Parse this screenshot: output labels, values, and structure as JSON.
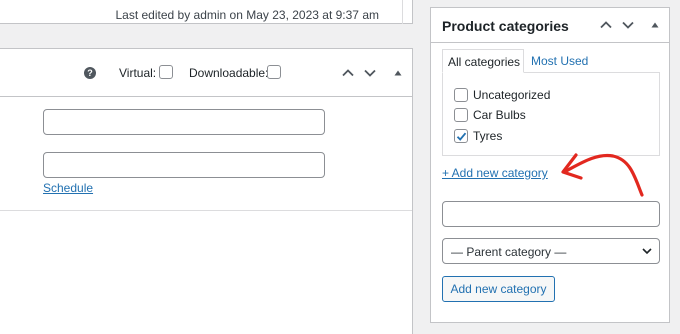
{
  "status": {
    "last_edited": "Last edited by admin on May 23, 2023 at 9:37 am"
  },
  "product_data": {
    "help_icon": "question-circle-icon",
    "virtual_label": "Virtual:",
    "virtual_checked": false,
    "downloadable_label": "Downloadable:",
    "downloadable_checked": false,
    "move_up_icon": "chevron-up-icon",
    "move_down_icon": "chevron-down-icon",
    "toggle_icon": "triangle-up-icon",
    "schedule_link": "Schedule"
  },
  "categories_box": {
    "title": "Product categories",
    "tabs": [
      {
        "label": "All categories",
        "active": true
      },
      {
        "label": "Most Used",
        "active": false
      }
    ],
    "items": [
      {
        "label": "Uncategorized",
        "checked": false
      },
      {
        "label": "Car Bulbs",
        "checked": false
      },
      {
        "label": "Tyres",
        "checked": true
      }
    ],
    "add_new_link": "+ Add new category",
    "new_category_value": "",
    "parent_select_value": "— Parent category —",
    "add_button_label": "Add new category"
  },
  "colors": {
    "link": "#2271b1",
    "border": "#c3c4c7",
    "annotation_arrow": "#e2281f",
    "background": "#f0f0f1"
  }
}
